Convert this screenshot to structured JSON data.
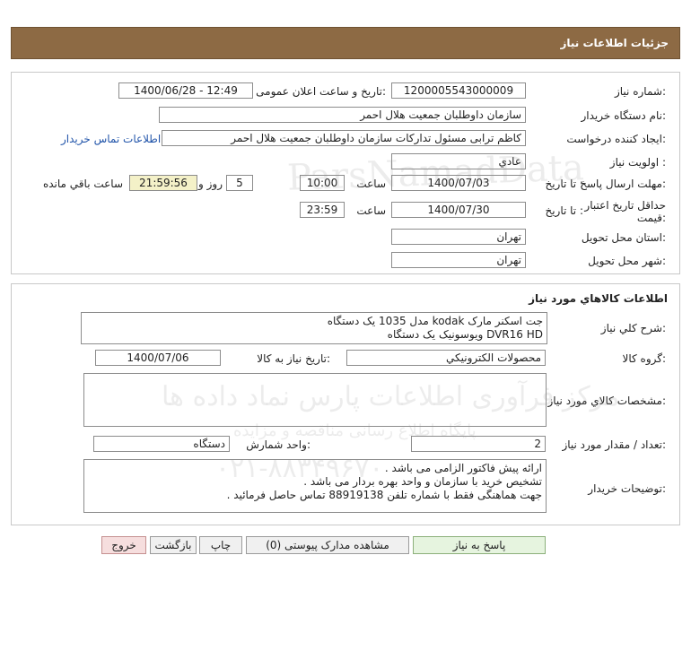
{
  "page": {
    "title": "جزئیات اطلاعات نیاز"
  },
  "details": {
    "need_number_label": "شماره نیاز:",
    "need_number": "1200005543000009",
    "announce_label": "تاریخ و ساعت اعلان عمومی:",
    "announce_value": "1400/06/28 - 12:49",
    "buyer_org_label": "نام دستگاه خریدار:",
    "buyer_org": "سازمان داوطلبان جمعیت هلال احمر",
    "creator_label": "ایجاد کننده درخواست:",
    "creator": "کاظم ترابی مسئول تدارکات سازمان داوطلبان جمعیت هلال احمر",
    "contact_link": "اطلاعات تماس خریدار",
    "priority_label": "اولویت نیاز :",
    "priority": "عادي",
    "deadline_label": "مهلت ارسال پاسخ:",
    "deadline_to_label": "تا تاریخ :",
    "deadline_date": "1400/07/03",
    "time_label": "ساعت",
    "deadline_time": "10:00",
    "days_value": "5",
    "days_label": "روز و",
    "remaining_time": "21:59:56",
    "remaining_label": "ساعت باقي مانده",
    "validity_label": "حداقل تاریخ اعتبار قیمت:",
    "validity_to_label": "تا تاریخ :",
    "validity_date": "1400/07/30",
    "validity_time_label": "ساعت",
    "validity_time": "23:59",
    "province_label": "استان محل تحویل:",
    "province": "تهران",
    "city_label": "شهر محل تحویل:",
    "city": "تهران"
  },
  "goods": {
    "section_title": "اطلاعات کالاهاي مورد نياز",
    "summary_label": "شرح کلي نياز:",
    "summary_line1": "جت اسکنر مارک kodak مدل 1035   یک دستگاه",
    "summary_line2": "DVR16 HD ویوسونیک  یک دستگاه",
    "group_label": "گروه کالا:",
    "group": "محصولات الكترونيكي",
    "need_date_label": "تاریخ نیاز به کالا:",
    "need_date": "1400/07/06",
    "specs_label": "مشخصات کالاي مورد نياز:",
    "qty_label": "تعداد / مقدار مورد نياز:",
    "qty": "2",
    "unit_label": "واحد شمارش:",
    "unit": "دستگاه",
    "notes_label": "توضیحات خریدار:",
    "notes_line1": "ارائه پیش فاکتور الزامی می باشد .",
    "notes_line2": "تشخیص خرید با سازمان و واحد بهره بردار می باشد .",
    "notes_line3": "جهت هماهنگی فقط با شماره تلفن 88919138 تماس حاصل فرمائید ."
  },
  "buttons": {
    "reply": "پاسخ به نیاز",
    "attachments": "مشاهده مدارک پیوستی (0)",
    "print": "چاپ",
    "back": "بازگشت",
    "exit": "خروج"
  },
  "watermark": {
    "line1": "ParsNamadData",
    "line2": "مرکز فرآوری اطلاعات پارس نماد داده ها",
    "line3": "پایگاه اطلاع رسانی مناقصه و مزایده",
    "line4": "۰۲۱-۸۸۳۴۹۶۷۰"
  },
  "colors": {
    "header": "#8d6a44",
    "remaining_bg": "#f4f1c8",
    "link": "#2255aa",
    "reply_btn": "#e6f4df",
    "exit_btn": "#f6dede"
  }
}
